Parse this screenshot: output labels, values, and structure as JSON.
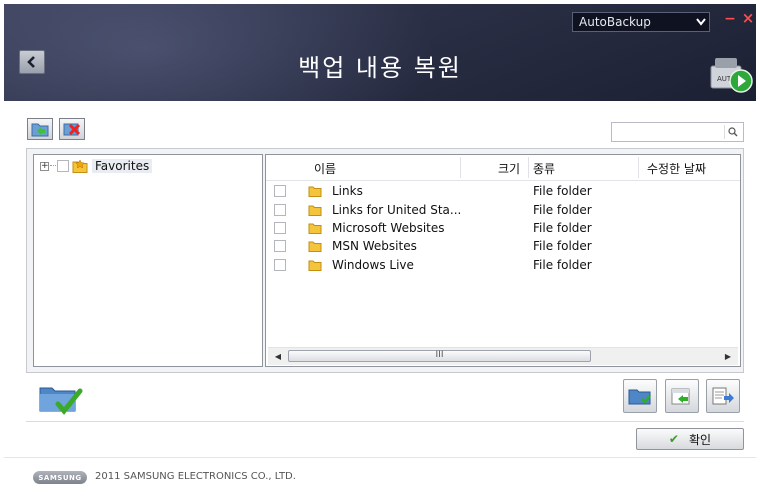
{
  "header": {
    "title": "백업 내용 복원",
    "mode_select_value": "AutoBackup",
    "minimize": "−",
    "close": "×"
  },
  "search": {
    "placeholder": "",
    "value": ""
  },
  "tree": {
    "items": [
      {
        "label": "Favorites",
        "expanded": false,
        "checked": false
      }
    ]
  },
  "file_list": {
    "columns": [
      "이름",
      "크기",
      "종류",
      "수정한 날짜"
    ],
    "rows": [
      {
        "name": "Links",
        "size": "",
        "type": "File folder",
        "modified": ""
      },
      {
        "name": "Links for United Sta...",
        "size": "",
        "type": "File folder",
        "modified": ""
      },
      {
        "name": "Microsoft Websites",
        "size": "",
        "type": "File folder",
        "modified": ""
      },
      {
        "name": "MSN Websites",
        "size": "",
        "type": "File folder",
        "modified": ""
      },
      {
        "name": "Windows Live",
        "size": "",
        "type": "File folder",
        "modified": ""
      }
    ],
    "scroll_thumb_label": "III"
  },
  "buttons": {
    "ok_label": "확인"
  },
  "footer": {
    "brand": "SAMSUNG",
    "copyright": "2011 SAMSUNG ELECTRONICS CO., LTD."
  },
  "colors": {
    "header_bg": "#2a2f45",
    "accent_green": "#3a9a2a",
    "close_red": "#ff4b4b"
  }
}
